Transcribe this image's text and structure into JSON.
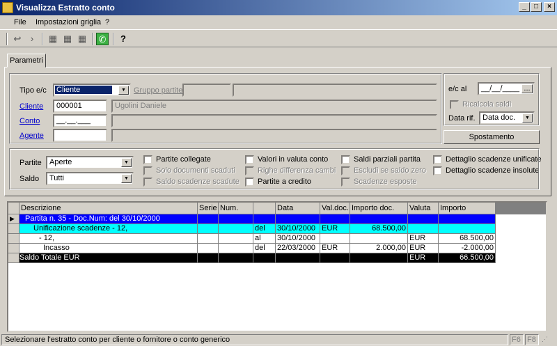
{
  "window": {
    "title": "Visualizza Estratto conto"
  },
  "menu": [
    {
      "label": "File"
    },
    {
      "label": "Impostazioni griglia"
    },
    {
      "label": "?"
    }
  ],
  "tabs": [
    {
      "label": "Parametri"
    }
  ],
  "params": {
    "tipo_ec_label": "Tipo e/c",
    "tipo_ec_value": "Cliente",
    "gruppo_partite_label": "Gruppo partite",
    "cliente_label": "Cliente",
    "cliente_code": "000001",
    "cliente_name": "Ugolini Daniele",
    "conto_label": "Conto",
    "conto_value": "__.__.___",
    "agente_label": "Agente",
    "ec_al_label": "e/c al",
    "ec_al_value": "__/__/____",
    "date_btn": "...",
    "ricalcola_label": "Ricalcola saldi",
    "data_rif_label": "Data rif.",
    "data_rif_value": "Data doc.",
    "spostamento_btn": "Spostamento",
    "partite_label": "Partite",
    "partite_value": "Aperte",
    "saldo_label": "Saldo",
    "saldo_value": "Tutti"
  },
  "checkboxes": [
    {
      "label": "Partite collegate",
      "enabled": true
    },
    {
      "label": "Solo documenti scaduti",
      "enabled": false
    },
    {
      "label": "Saldo scadenze scadute",
      "enabled": false
    },
    {
      "label": "Valori in valuta conto",
      "enabled": true
    },
    {
      "label": "Righe differenza cambi",
      "enabled": false
    },
    {
      "label": "Partite a credito",
      "enabled": true
    },
    {
      "label": "Saldi parziali partita",
      "enabled": true
    },
    {
      "label": "Escludi se saldo zero",
      "enabled": false
    },
    {
      "label": "Scadenze esposte",
      "enabled": false
    },
    {
      "label": "Dettaglio scadenze unificate",
      "enabled": true
    },
    {
      "label": "Dettaglio scadenze insolute",
      "enabled": true
    }
  ],
  "grid": {
    "columns": [
      "Descrizione",
      "Serie",
      "Num.",
      "",
      "Data",
      "Val.doc.",
      "Importo doc.",
      "Valuta",
      "Importo"
    ],
    "rows": [
      [
        "Partita n. 35 - Doc.Num:  del 30/10/2000",
        "",
        "",
        "",
        "",
        "",
        "",
        "",
        ""
      ],
      [
        "Unificazione scadenze - 12,",
        "",
        "",
        "del",
        "30/10/2000",
        "EUR",
        "68.500,00",
        "",
        ""
      ],
      [
        "- 12,",
        "",
        "",
        "al",
        "30/10/2000",
        "",
        "",
        "EUR",
        "68.500,00"
      ],
      [
        "Incasso",
        "",
        "",
        "del",
        "22/03/2000",
        "EUR",
        "2.000,00",
        "EUR",
        "-2.000,00"
      ],
      [
        "Saldo Totale EUR",
        "",
        "",
        "",
        "",
        "",
        "",
        "EUR",
        "66.500,00"
      ]
    ],
    "row_colors": [
      "#0000ff",
      "#00ffff",
      "#ffffff",
      "#ffffff",
      "#000000"
    ],
    "row_text_colors": [
      "#ffffff",
      "#000000",
      "#000000",
      "#000000",
      "#ffffff"
    ]
  },
  "status": {
    "message": "Selezionare l'estratto conto per cliente o fornitore o conto generico",
    "f6": "F6",
    "f8": "F8"
  }
}
